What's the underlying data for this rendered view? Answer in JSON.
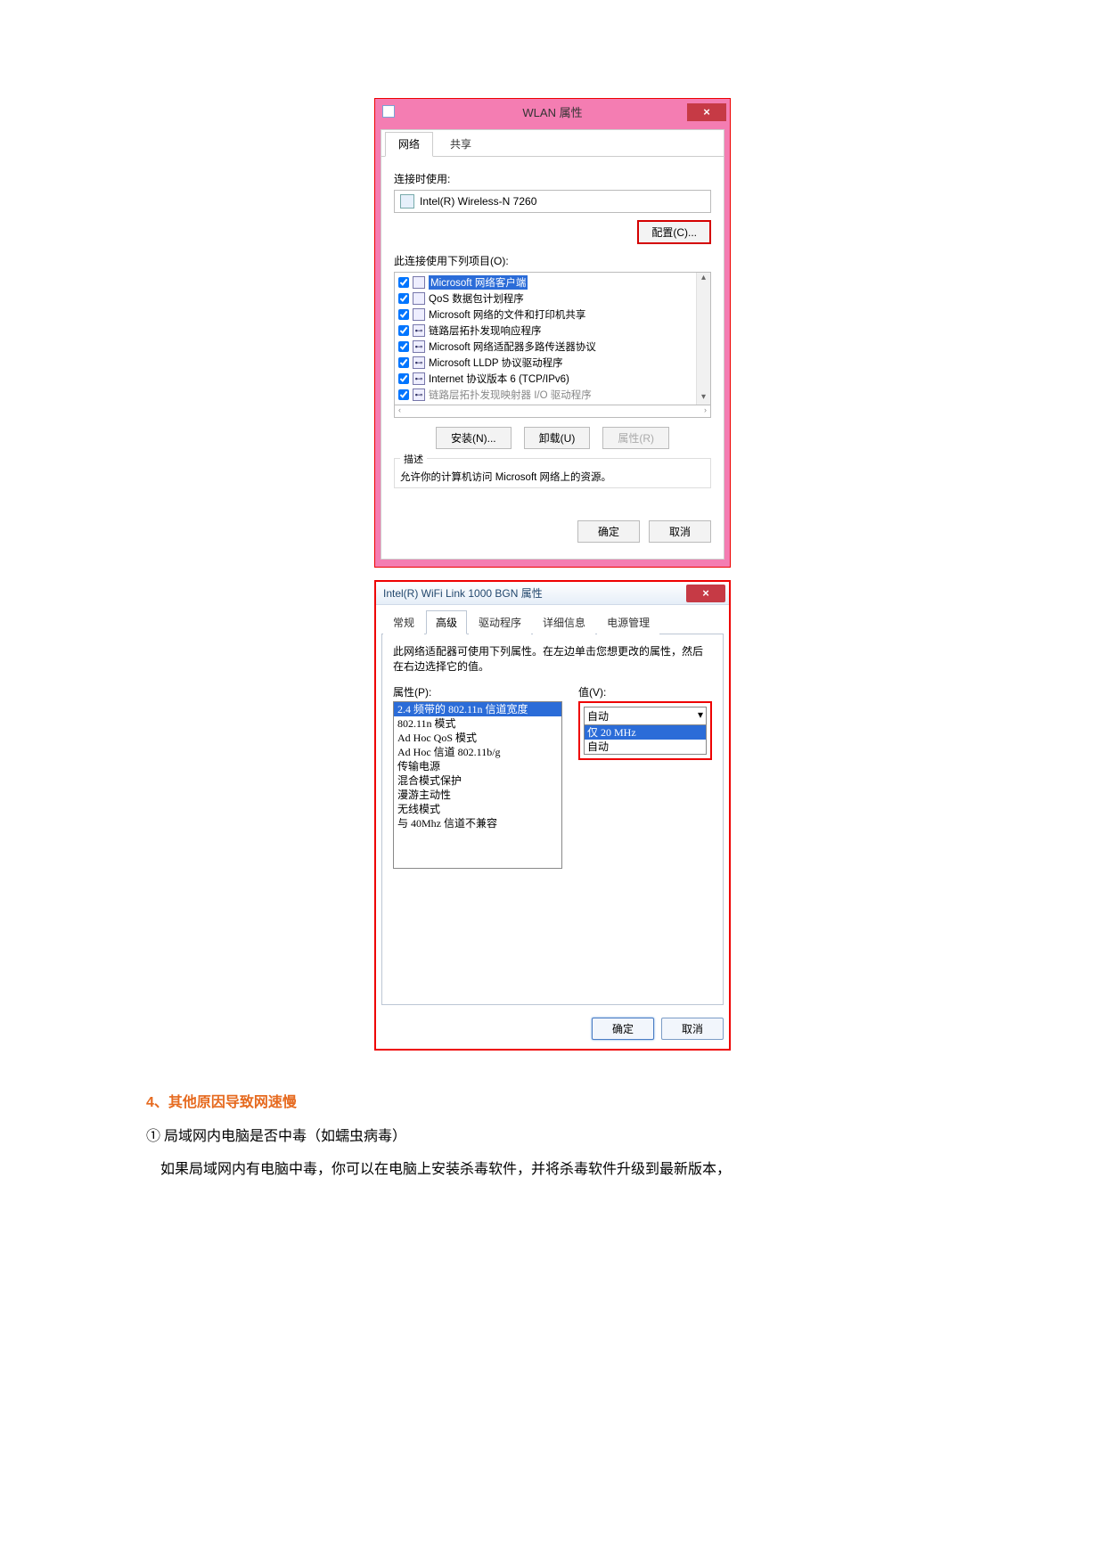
{
  "dialog1": {
    "title": "WLAN 属性",
    "close": "×",
    "tabs": {
      "network": "网络",
      "share": "共享"
    },
    "connect_label": "连接时使用:",
    "adapter": "Intel(R) Wireless-N 7260",
    "configure": "配置(C)...",
    "items_label": "此连接使用下列项目(O):",
    "items": [
      "Microsoft 网络客户端",
      "QoS 数据包计划程序",
      "Microsoft 网络的文件和打印机共享",
      "链路层拓扑发现响应程序",
      "Microsoft 网络适配器多路传送器协议",
      "Microsoft LLDP 协议驱动程序",
      "Internet 协议版本 6 (TCP/IPv6)",
      "链路层拓扑发现映射器 I/O 驱动程序"
    ],
    "install": "安装(N)...",
    "uninstall": "卸载(U)",
    "props": "属性(R)",
    "desc_label": "描述",
    "desc_text": "允许你的计算机访问 Microsoft 网络上的资源。",
    "ok": "确定",
    "cancel": "取消"
  },
  "dialog2": {
    "title": "Intel(R) WiFi Link 1000 BGN 属性",
    "close": "×",
    "tabs": [
      "常规",
      "高级",
      "驱动程序",
      "详细信息",
      "电源管理"
    ],
    "active_tab": 1,
    "instruction": "此网络适配器可使用下列属性。在左边单击您想更改的属性，然后在右边选择它的值。",
    "prop_label": "属性(P):",
    "value_label": "值(V):",
    "properties": [
      "2.4 频带的 802.11n 信道宽度",
      "802.11n 模式",
      "Ad Hoc QoS 模式",
      "Ad Hoc 信道 802.11b/g",
      "传输电源",
      "混合模式保护",
      "漫游主动性",
      "无线模式",
      "与 40Mhz 信道不兼容"
    ],
    "selected": "自动",
    "dropdown": [
      "仅 20 MHz",
      "自动"
    ],
    "ok": "确定",
    "cancel": "取消"
  },
  "text": {
    "heading": "4、其他原因导致网速慢",
    "line1": "①  局域网内电脑是否中毒（如蠕虫病毒）",
    "line2": "如果局域网内有电脑中毒，你可以在电脑上安装杀毒软件，并将杀毒软件升级到最新版本，"
  }
}
